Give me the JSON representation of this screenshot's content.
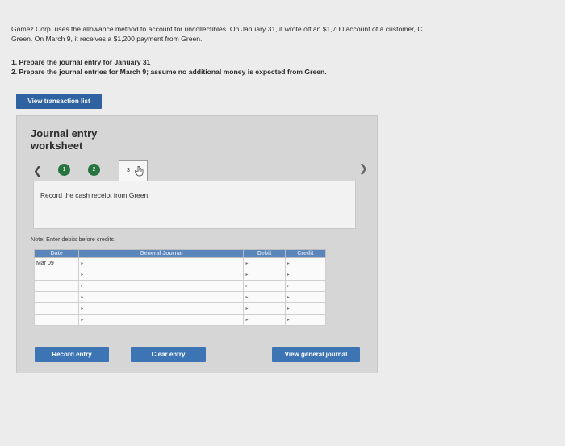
{
  "problem": {
    "text_line1": "Gomez Corp. uses the allowance method to account for uncollectibles. On January 31, it wrote off an $1,700 account of a customer, C.",
    "text_line2": "Green. On March 9, it receives a $1,200 payment from Green.",
    "task1": "1. Prepare the journal entry for January 31",
    "task2": "2. Prepare the journal entries for March 9; assume no additional money is expected from Green."
  },
  "buttons": {
    "view_transaction": "View transaction list",
    "record_entry": "Record entry",
    "clear_entry": "Clear entry",
    "view_general_journal": "View general journal"
  },
  "worksheet": {
    "title_line1": "Journal entry",
    "title_line2": "worksheet",
    "prev_icon": "chevron-left",
    "next_icon": "chevron-right",
    "steps": [
      "1",
      "2",
      "3"
    ],
    "instruction": "Record the cash receipt from Green.",
    "note": "Note: Enter debits before credits."
  },
  "journal": {
    "headers": [
      "Date",
      "General Journal",
      "Debit",
      "Credit"
    ],
    "rows": [
      {
        "date": "Mar 09",
        "account": "",
        "debit": "",
        "credit": ""
      },
      {
        "date": "",
        "account": "",
        "debit": "",
        "credit": ""
      },
      {
        "date": "",
        "account": "",
        "debit": "",
        "credit": ""
      },
      {
        "date": "",
        "account": "",
        "debit": "",
        "credit": ""
      },
      {
        "date": "",
        "account": "",
        "debit": "",
        "credit": ""
      },
      {
        "date": "",
        "account": "",
        "debit": "",
        "credit": ""
      }
    ]
  }
}
